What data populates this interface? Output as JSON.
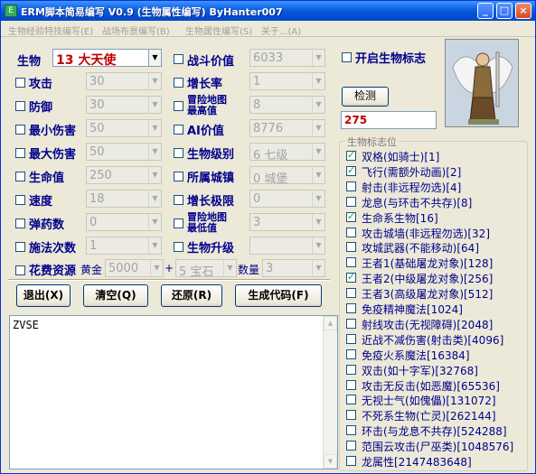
{
  "window": {
    "title": "ERM脚本简易编写 V0.9 (生物属性编写) ByHanter007",
    "app_icon_label": "E",
    "minimize_icon": "minimize-icon",
    "maximize_icon": "maximize-icon",
    "close_icon": "close-icon",
    "min_symbol": "_",
    "max_symbol": "□",
    "close_symbol": "×"
  },
  "menu": [
    {
      "label": "生物经验特技编写(E)"
    },
    {
      "label": "战场布景编写(B)"
    },
    {
      "label": "生物属性编写(S)"
    },
    {
      "label": "关于...(A)"
    }
  ],
  "creature": {
    "label": "生物",
    "value": "13   大天使"
  },
  "left_fields": [
    {
      "label": "攻击",
      "value": "30"
    },
    {
      "label": "防御",
      "value": "30"
    },
    {
      "label": "最小伤害",
      "value": "50"
    },
    {
      "label": "最大伤害",
      "value": "50"
    },
    {
      "label": "生命值",
      "value": "250"
    },
    {
      "label": "速度",
      "value": "18"
    },
    {
      "label": "弹药数",
      "value": "0"
    },
    {
      "label": "施法次数",
      "value": "1"
    }
  ],
  "mid_fields": [
    {
      "label": "战斗价值",
      "value": "6033"
    },
    {
      "label": "增长率",
      "value": "1"
    },
    {
      "label_line1": "冒险地图",
      "label_line2": "最高值",
      "value": "8"
    },
    {
      "label": "AI价值",
      "value": "8776"
    },
    {
      "label": "生物级别",
      "value": "6  七级"
    },
    {
      "label": "所属城镇",
      "value": "0  城堡"
    },
    {
      "label": "增长极限",
      "value": "0"
    },
    {
      "label_line1": "冒险地图",
      "label_line2": "最低值",
      "value": "3"
    },
    {
      "label": "生物升级",
      "value": ""
    }
  ],
  "cost": {
    "label": "花费资源",
    "gold_label": "黄金",
    "gold_value": "5000",
    "plus": "+",
    "resource_value": "5  宝石",
    "qty_label": "数量",
    "qty_value": "3"
  },
  "buttons": {
    "exit": "退出(X)",
    "clear": "清空(Q)",
    "restore": "还原(R)",
    "generate": "生成代码(F)",
    "detect": "检测"
  },
  "output_text": "ZVSE",
  "enable_flags_label": "开启生物标志",
  "flag_value": "275",
  "flags_group_title": "生物标志位",
  "flags": [
    {
      "label": "双格(如骑士)[1]",
      "checked": true
    },
    {
      "label": "飞行(需额外动画)[2]",
      "checked": true
    },
    {
      "label": "射击(非远程勿选)[4]",
      "checked": false
    },
    {
      "label": "龙息(与环击不共存)[8]",
      "checked": false
    },
    {
      "label": "生命系生物[16]",
      "checked": true
    },
    {
      "label": "攻击城墙(非远程勿选)[32]",
      "checked": false
    },
    {
      "label": "攻城武器(不能移动)[64]",
      "checked": false
    },
    {
      "label": "王者1(基础屠龙对象)[128]",
      "checked": false
    },
    {
      "label": "王者2(中级屠龙对象)[256]",
      "checked": true
    },
    {
      "label": "王者3(高级屠龙对象)[512]",
      "checked": false
    },
    {
      "label": "免疫精神魔法[1024]",
      "checked": false
    },
    {
      "label": "射线攻击(无视障碍)[2048]",
      "checked": false
    },
    {
      "label": "近战不减伤害(射击类)[4096]",
      "checked": false
    },
    {
      "label": "免疫火系魔法[16384]",
      "checked": false
    },
    {
      "label": "双击(如十字军)[32768]",
      "checked": false
    },
    {
      "label": "攻击无反击(如恶魔)[65536]",
      "checked": false
    },
    {
      "label": "无视士气(如傀儡)[131072]",
      "checked": false
    },
    {
      "label": "不死系生物(亡灵)[262144]",
      "checked": false
    },
    {
      "label": "环击(与龙息不共存)[524288]",
      "checked": false
    },
    {
      "label": "范围云攻击(尸巫类)[1048576]",
      "checked": false
    },
    {
      "label": "龙属性[2147483648]",
      "checked": false
    }
  ]
}
